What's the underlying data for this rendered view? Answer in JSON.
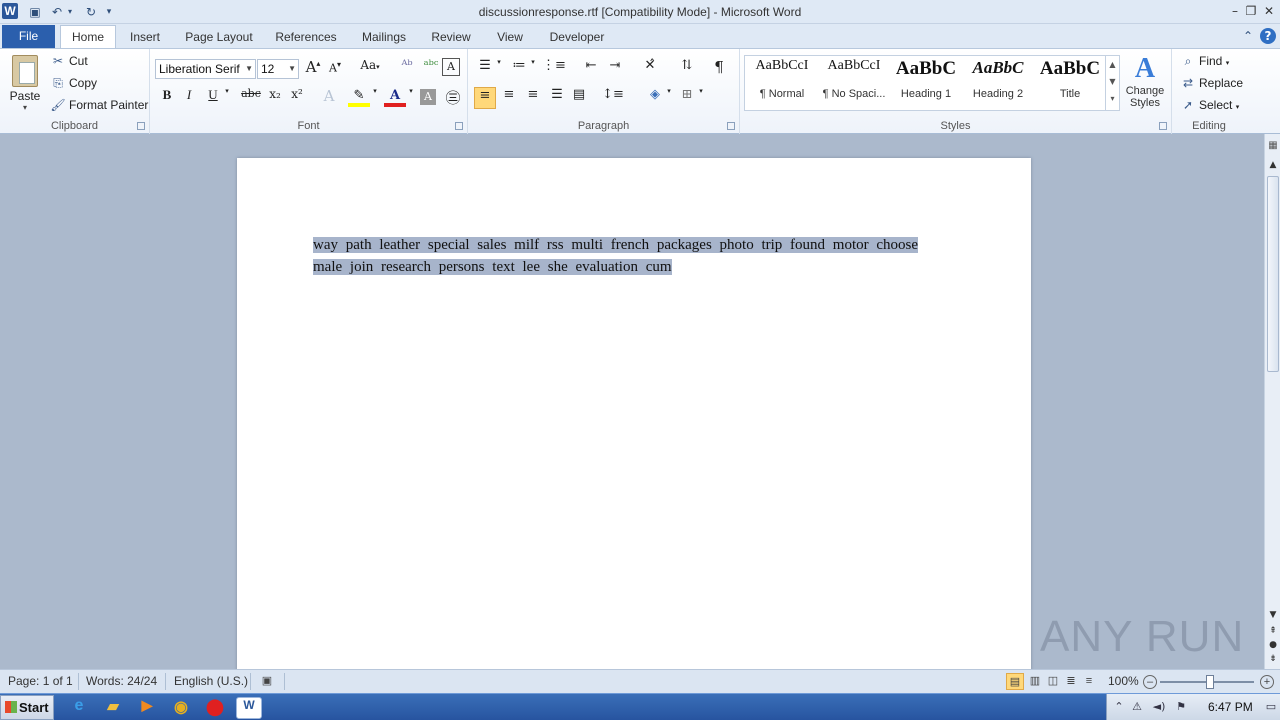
{
  "window": {
    "title": "discussionresponse.rtf [Compatibility Mode]  -  Microsoft Word",
    "app_logo": "W"
  },
  "ribbon_tabs": {
    "file": "File",
    "home": "Home",
    "insert": "Insert",
    "page_layout": "Page Layout",
    "references": "References",
    "mailings": "Mailings",
    "review": "Review",
    "view": "View",
    "developer": "Developer"
  },
  "clipboard": {
    "paste": "Paste",
    "cut": "Cut",
    "copy": "Copy",
    "format_painter": "Format Painter",
    "label": "Clipboard"
  },
  "font": {
    "name": "Liberation Serif",
    "size": "12",
    "label": "Font",
    "bold": "B",
    "italic": "I",
    "underline": "U",
    "strikethrough": "abc",
    "subscript": "x₂",
    "superscript": "x²",
    "change_case": "Aa",
    "grow": "A",
    "shrink": "A"
  },
  "paragraph": {
    "label": "Paragraph",
    "pilcrow": "¶"
  },
  "styles": {
    "label": "Styles",
    "change_styles": "Change Styles",
    "items": [
      {
        "sample": "AaBbCcI",
        "name": "¶ Normal"
      },
      {
        "sample": "AaBbCcI",
        "name": "¶ No Spaci..."
      },
      {
        "sample": "AaBbC",
        "name": "Heading 1"
      },
      {
        "sample": "AaBbC",
        "name": "Heading 2"
      },
      {
        "sample": "AaBbC",
        "name": "Title"
      }
    ]
  },
  "editing": {
    "label": "Editing",
    "find": "Find",
    "replace": "Replace",
    "select": "Select"
  },
  "document": {
    "text": "way path leather      special       sales     milf  rss multi  french      packages photo     trip found  motor choose male        join research  persons text     lee she  evaluation         cum"
  },
  "statusbar": {
    "page": "Page: 1 of 1",
    "words": "Words: 24/24",
    "language": "English (U.S.)",
    "zoom": "100%",
    "zoom_level": 1.0
  },
  "taskbar": {
    "start": "Start",
    "time": "6:47 PM"
  },
  "watermark": "ANY RUN",
  "colors": {
    "selection": "#a7b4cb",
    "file_tab": "#2b5fad",
    "word_blue": "#2b579a",
    "highlight": "#ffd87a"
  }
}
